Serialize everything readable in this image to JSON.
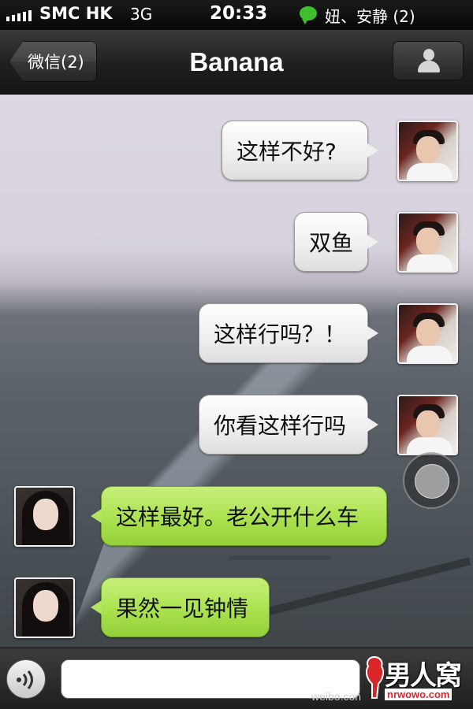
{
  "status_bar": {
    "carrier": "SMC HK",
    "network": "3G",
    "time": "20:33",
    "notification": "妞、安静 (2)",
    "notification_icon": "wechat-bubble-icon"
  },
  "nav": {
    "back_label": "微信(2)",
    "title": "Banana",
    "contact_icon": "person-icon"
  },
  "messages": [
    {
      "sender": "me",
      "text": "这样不好?"
    },
    {
      "sender": "me",
      "text": "双鱼"
    },
    {
      "sender": "me",
      "text": "这样行吗？！"
    },
    {
      "sender": "me",
      "text": "你看这样行吗"
    },
    {
      "sender": "other",
      "text": "这样最好。老公开什么车"
    },
    {
      "sender": "other",
      "text": "果然一见钟情"
    }
  ],
  "input_bar": {
    "voice_icon": "voice-icon",
    "text_value": ""
  },
  "watermarks": {
    "weibo": "weibo.con",
    "logo_text": "男人窝",
    "logo_url": "nrwowo.com"
  },
  "colors": {
    "my_bubble": "#f2f2f2",
    "their_bubble": "#a8e04c",
    "nav_bar": "#1f1f1f"
  }
}
